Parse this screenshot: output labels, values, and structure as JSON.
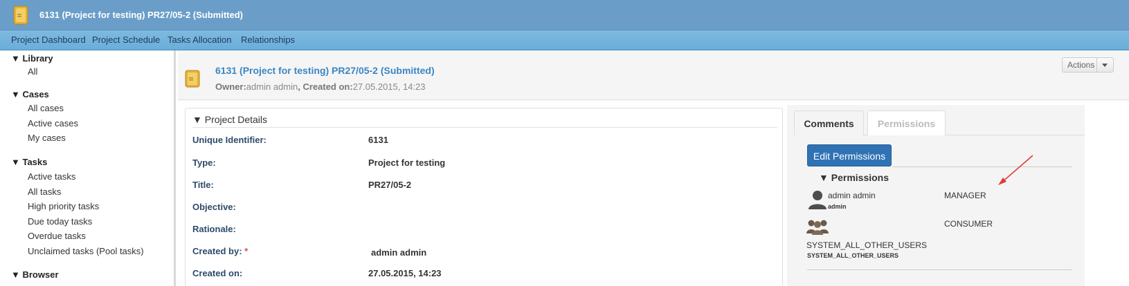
{
  "window": {
    "title": "6131 (Project for testing) PR27/05-2 (Submitted)"
  },
  "nav": {
    "items": [
      "Project Dashboard",
      "Project Schedule",
      "Tasks Allocation",
      "Relationships"
    ]
  },
  "sidebar": {
    "sections": [
      {
        "label": "▼ Library",
        "items": [
          "All"
        ]
      },
      {
        "label": "▼ Cases",
        "items": [
          "All cases",
          "Active cases",
          "My cases"
        ]
      },
      {
        "label": "▼ Tasks",
        "items": [
          "Active tasks",
          "All tasks",
          "High priority tasks",
          "Due today tasks",
          "Overdue tasks",
          "Unclaimed tasks (Pool tasks)"
        ]
      },
      {
        "label": "▼ Browser",
        "items": []
      }
    ]
  },
  "header": {
    "title": "6131 (Project for testing) PR27/05-2 (Submitted)",
    "owner_label": "Owner:",
    "owner_value": "admin admin",
    "created_label": ", Created on:",
    "created_value": "27.05.2015, 14:23",
    "actions_label": "Actions"
  },
  "details": {
    "heading": "▼ Project Details",
    "fields": [
      {
        "label": "Unique Identifier:",
        "value": "6131",
        "required": ""
      },
      {
        "label": "Type:",
        "value": "Project for testing",
        "required": ""
      },
      {
        "label": "Title:",
        "value": "PR27/05-2",
        "required": ""
      },
      {
        "label": "Objective:",
        "value": "",
        "required": ""
      },
      {
        "label": "Rationale:",
        "value": "",
        "required": ""
      },
      {
        "label": "Created by:",
        "value": " admin admin",
        "required": "*"
      },
      {
        "label": "Created on:",
        "value": "27.05.2015, 14:23",
        "required": ""
      }
    ]
  },
  "right_panel": {
    "tabs": [
      {
        "label": "Comments",
        "active": true
      },
      {
        "label": "Permissions",
        "active": false
      }
    ],
    "edit_button": "Edit Permissions",
    "permissions_heading": "▼ Permissions",
    "entries": [
      {
        "name": "admin admin",
        "user": "admin",
        "role": "MANAGER",
        "icon": "user-icon"
      },
      {
        "name": "SYSTEM_ALL_OTHER_USERS",
        "user": "SYSTEM_ALL_OTHER_USERS",
        "role": "CONSUMER",
        "icon": "group-icon"
      }
    ]
  },
  "colors": {
    "titlebar": "#6a9ec9",
    "link": "#3a86c4",
    "button": "#2f73b5",
    "annotation_arrow": "#e53935"
  }
}
